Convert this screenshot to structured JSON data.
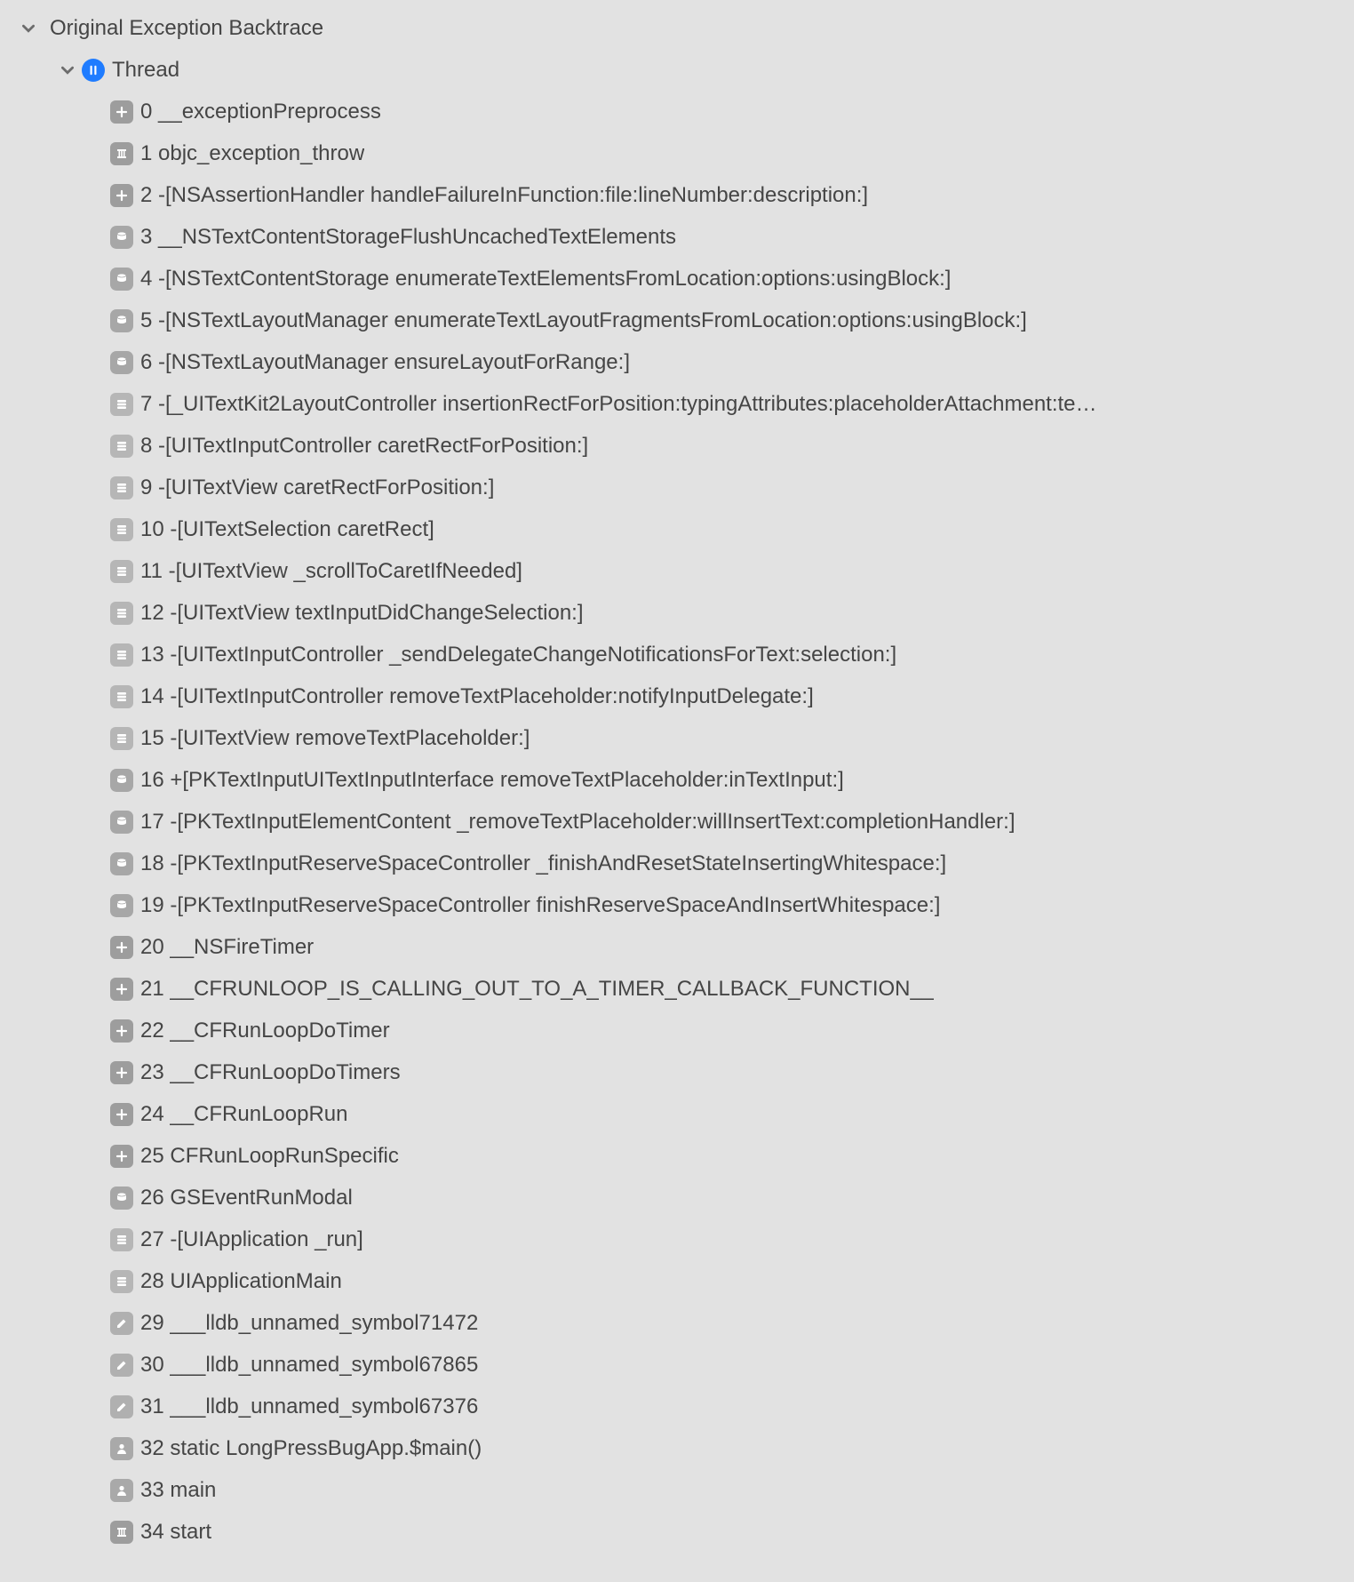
{
  "root": {
    "title": "Original Exception Backtrace",
    "thread_label": "Thread",
    "frames": [
      {
        "idx": 0,
        "icon": "plus",
        "text": "__exceptionPreprocess"
      },
      {
        "idx": 1,
        "icon": "pillar",
        "text": "objc_exception_throw"
      },
      {
        "idx": 2,
        "icon": "plus",
        "text": "-[NSAssertionHandler handleFailureInFunction:file:lineNumber:description:]"
      },
      {
        "idx": 3,
        "icon": "db",
        "text": "__NSTextContentStorageFlushUncachedTextElements"
      },
      {
        "idx": 4,
        "icon": "db",
        "text": "-[NSTextContentStorage enumerateTextElementsFromLocation:options:usingBlock:]"
      },
      {
        "idx": 5,
        "icon": "db",
        "text": "-[NSTextLayoutManager enumerateTextLayoutFragmentsFromLocation:options:usingBlock:]"
      },
      {
        "idx": 6,
        "icon": "db",
        "text": "-[NSTextLayoutManager ensureLayoutForRange:]"
      },
      {
        "idx": 7,
        "icon": "stack",
        "text": "-[_UITextKit2LayoutController insertionRectForPosition:typingAttributes:placeholderAttachment:te…"
      },
      {
        "idx": 8,
        "icon": "stack",
        "text": "-[UITextInputController caretRectForPosition:]"
      },
      {
        "idx": 9,
        "icon": "stack",
        "text": "-[UITextView caretRectForPosition:]"
      },
      {
        "idx": 10,
        "icon": "stack",
        "text": "-[UITextSelection caretRect]"
      },
      {
        "idx": 11,
        "icon": "stack",
        "text": "-[UITextView _scrollToCaretIfNeeded]"
      },
      {
        "idx": 12,
        "icon": "stack",
        "text": "-[UITextView textInputDidChangeSelection:]"
      },
      {
        "idx": 13,
        "icon": "stack",
        "text": "-[UITextInputController _sendDelegateChangeNotificationsForText:selection:]"
      },
      {
        "idx": 14,
        "icon": "stack",
        "text": "-[UITextInputController removeTextPlaceholder:notifyInputDelegate:]"
      },
      {
        "idx": 15,
        "icon": "stack",
        "text": "-[UITextView removeTextPlaceholder:]"
      },
      {
        "idx": 16,
        "icon": "db",
        "text": "+[PKTextInputUITextInputInterface removeTextPlaceholder:inTextInput:]"
      },
      {
        "idx": 17,
        "icon": "db",
        "text": "-[PKTextInputElementContent _removeTextPlaceholder:willInsertText:completionHandler:]"
      },
      {
        "idx": 18,
        "icon": "db",
        "text": "-[PKTextInputReserveSpaceController _finishAndResetStateInsertingWhitespace:]"
      },
      {
        "idx": 19,
        "icon": "db",
        "text": "-[PKTextInputReserveSpaceController finishReserveSpaceAndInsertWhitespace:]"
      },
      {
        "idx": 20,
        "icon": "plus",
        "text": "__NSFireTimer"
      },
      {
        "idx": 21,
        "icon": "plus",
        "text": "__CFRUNLOOP_IS_CALLING_OUT_TO_A_TIMER_CALLBACK_FUNCTION__"
      },
      {
        "idx": 22,
        "icon": "plus",
        "text": "__CFRunLoopDoTimer"
      },
      {
        "idx": 23,
        "icon": "plus",
        "text": "__CFRunLoopDoTimers"
      },
      {
        "idx": 24,
        "icon": "plus",
        "text": "__CFRunLoopRun"
      },
      {
        "idx": 25,
        "icon": "plus",
        "text": "CFRunLoopRunSpecific"
      },
      {
        "idx": 26,
        "icon": "db",
        "text": "GSEventRunModal"
      },
      {
        "idx": 27,
        "icon": "stack",
        "text": "-[UIApplication _run]"
      },
      {
        "idx": 28,
        "icon": "stack",
        "text": "UIApplicationMain"
      },
      {
        "idx": 29,
        "icon": "pencil",
        "text": "___lldb_unnamed_symbol71472"
      },
      {
        "idx": 30,
        "icon": "pencil",
        "text": "___lldb_unnamed_symbol67865"
      },
      {
        "idx": 31,
        "icon": "pencil",
        "text": "___lldb_unnamed_symbol67376"
      },
      {
        "idx": 32,
        "icon": "person",
        "text": "static LongPressBugApp.$main()"
      },
      {
        "idx": 33,
        "icon": "person",
        "text": "main"
      },
      {
        "idx": 34,
        "icon": "pillar",
        "text": "start"
      }
    ]
  }
}
